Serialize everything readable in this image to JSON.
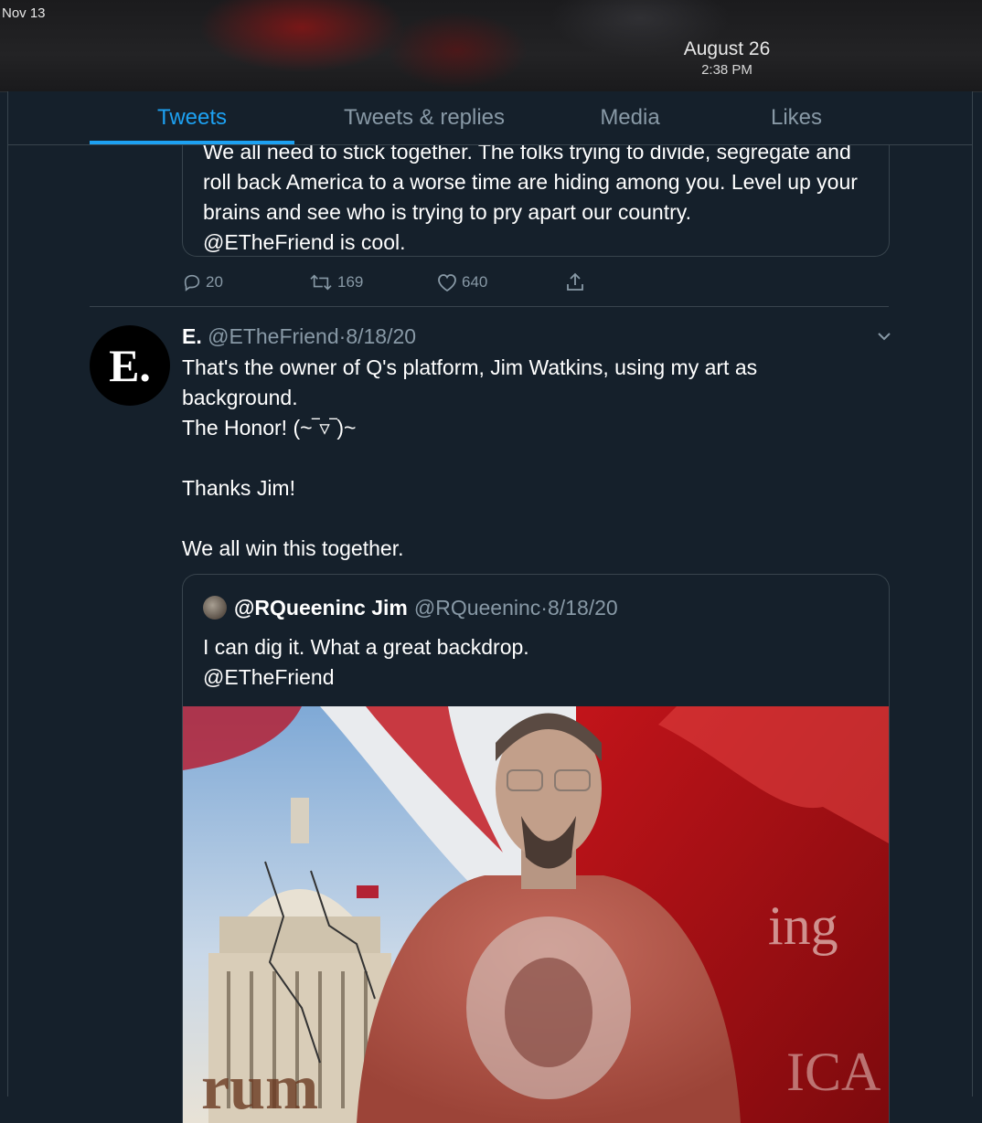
{
  "status": {
    "corner_date": "Nov 13",
    "date": "August 26",
    "time": "2:38 PM"
  },
  "tabs": [
    {
      "label": "Tweets",
      "active": true
    },
    {
      "label": "Tweets & replies",
      "active": false
    },
    {
      "label": "Media",
      "active": false
    },
    {
      "label": "Likes",
      "active": false
    }
  ],
  "previous_tweet": {
    "quote_text": "We all need to stick together. The folks trying to divide, segregate and roll back America to a worse time are hiding among you. Level up your brains and see who is trying to pry apart our country.\n@ETheFriend is cool.",
    "replies": "20",
    "retweets": "169",
    "likes": "640"
  },
  "tweet": {
    "avatar_letter": "E.",
    "name": "E.",
    "handle": "@ETheFriend",
    "separator": "·",
    "date": "8/18/20",
    "lines": [
      "That's the owner of Q's platform, Jim Watkins, using my art as background.",
      "The Honor! (~‾▿‾)~",
      "",
      "Thanks Jim!",
      "",
      "We all win this together."
    ]
  },
  "quoted": {
    "name": "@RQueeninc Jim",
    "handle": "@RQueeninc",
    "separator": "·",
    "date": "8/18/20",
    "text": "I can dig it. What a great backdrop.\n@ETheFriend"
  },
  "colors": {
    "background": "#15202b",
    "accent": "#1da1f2",
    "muted": "#8899a6",
    "border": "#38444d"
  }
}
